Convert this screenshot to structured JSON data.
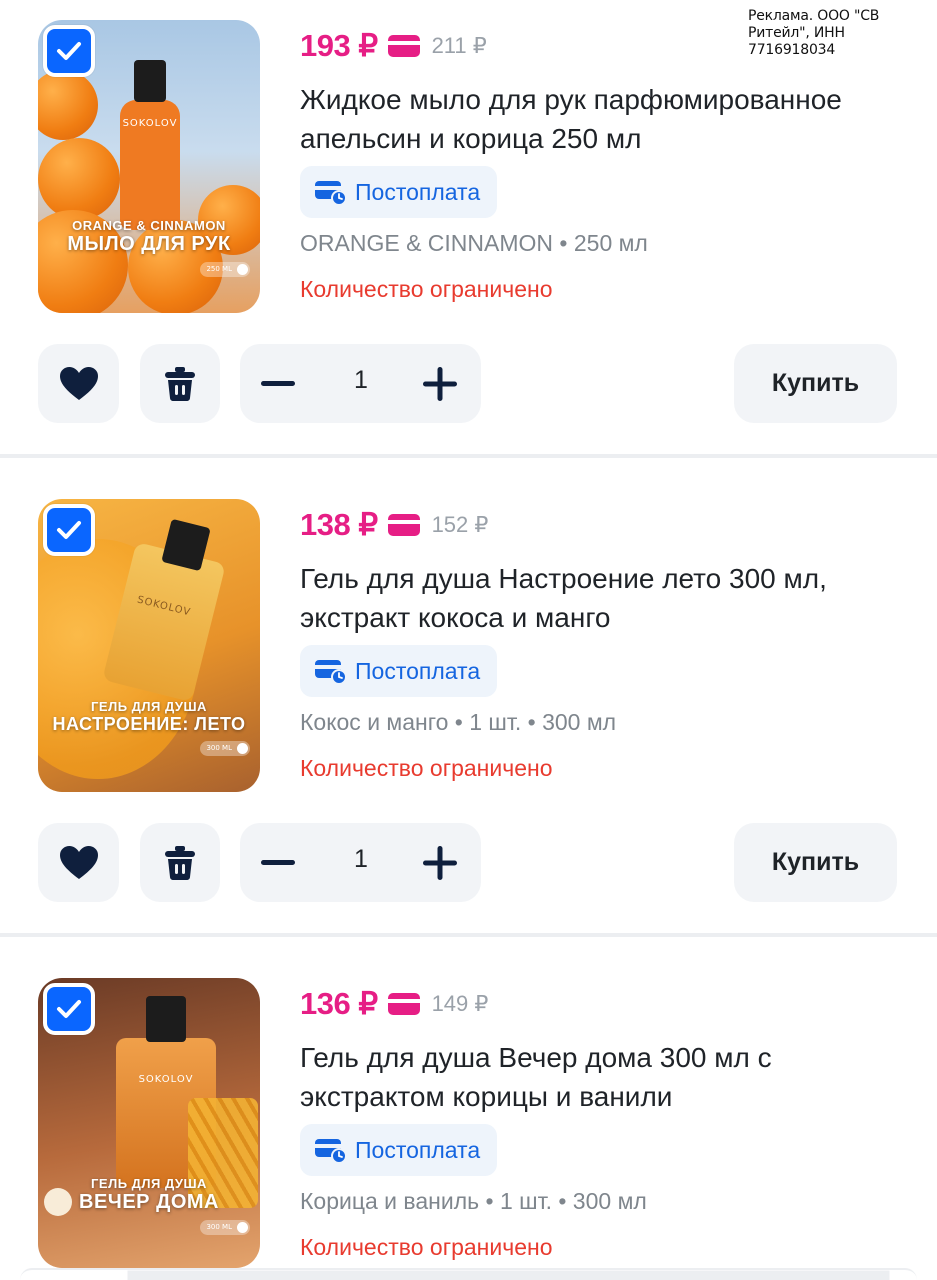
{
  "ad": {
    "text": "Реклама. ООО \"СВ Ритейл\", ИНН 7716918034"
  },
  "products": [
    {
      "price": "193 ₽",
      "old_price": "211 ₽",
      "title": "Жидкое мыло для рук парфюмированное апельсин и корица 250 мл",
      "payment_label": "Постоплата",
      "specs": "ORANGE & CINNAMON • 250 мл",
      "availability": "Количество ограничено",
      "quantity": "1",
      "buy_label": "Купить",
      "image": {
        "brand": "SOKOLOV",
        "sub": "ORANGE & CINNAMON",
        "main": "МЫЛО ДЛЯ РУК",
        "volume": "250 ML"
      }
    },
    {
      "price": "138 ₽",
      "old_price": "152 ₽",
      "title": "Гель для душа Настроение лето 300 мл, экстракт кокоса и манго",
      "payment_label": "Постоплата",
      "specs": "Кокос и манго • 1 шт. • 300 мл",
      "availability": "Количество ограничено",
      "quantity": "1",
      "buy_label": "Купить",
      "image": {
        "brand": "SOKOLOV",
        "sub": "ГЕЛЬ ДЛЯ ДУША",
        "main": "НАСТРОЕНИЕ: ЛЕТО",
        "volume": "300 ML"
      }
    },
    {
      "price": "136 ₽",
      "old_price": "149 ₽",
      "title": "Гель для душа Вечер дома 300 мл с экстрактом корицы и ванили",
      "payment_label": "Постоплата",
      "specs": "Корица и ваниль • 1 шт. • 300 мл",
      "availability": "Количество ограничено",
      "image": {
        "brand": "SOKOLOV",
        "sub": "ГЕЛЬ ДЛЯ ДУША",
        "main": "ВЕЧЕР ДОМА",
        "volume": "300 ML"
      }
    }
  ],
  "colors": {
    "price": "#e61e85",
    "accent_blue": "#0a66ff",
    "payment_text": "#1565e0",
    "limited": "#e83b2f",
    "button_bg": "#f2f4f7",
    "icon_dark": "#0f1f3d"
  },
  "icons": {
    "checkbox": "checkmark-icon",
    "card": "bank-card-icon",
    "payment": "postpay-card-clock-icon",
    "favorite": "heart-icon",
    "delete": "trash-icon",
    "decrement": "minus-icon",
    "increment": "plus-icon"
  }
}
